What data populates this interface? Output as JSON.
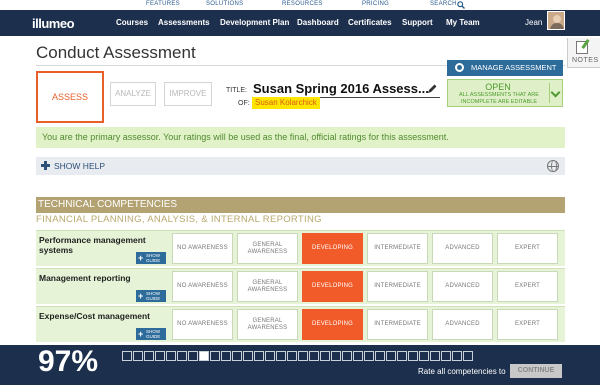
{
  "topbar": {
    "features": "FEATURES",
    "solutions": "SOLUTIONS",
    "resources": "RESOURCES",
    "pricing": "PRICING",
    "search": "SEARCH"
  },
  "nav": {
    "logo": "illumeo",
    "items": [
      "Courses",
      "Assessments",
      "Development Plan",
      "Dashboard",
      "Certificates",
      "Support",
      "My Team"
    ],
    "user": "Jean"
  },
  "notes_label": "NOTES",
  "page_title": "Conduct Assessment",
  "steps": {
    "assess": "ASSESS",
    "analyze": "ANALYZE",
    "improve": "IMPROVE"
  },
  "assessment": {
    "title_label": "TITLE:",
    "title_value": "Susan Spring 2016 Assess...",
    "of_label": "OF:",
    "of_value": "Susan Kolarchick"
  },
  "manage_button": "MANAGE ASSESSMENT",
  "status": {
    "title": "OPEN",
    "subtitle": "ALL ASSESSMENTS THAT ARE INCOMPLETE ARE EDITABLE"
  },
  "notice": "You are the primary assessor. Your ratings will be used as the final, official ratings for this assessment.",
  "help_label": "SHOW HELP",
  "section_header": "TECHNICAL COMPETENCIES",
  "sub_header": "FINANCIAL PLANNING, ANALYSIS, & INTERNAL REPORTING",
  "rating_levels": [
    "NO AWARENESS",
    "GENERAL AWARENESS",
    "DEVELOPING",
    "INTERMEDIATE",
    "ADVANCED",
    "EXPERT"
  ],
  "show_guide": {
    "plus": "+",
    "text": "SHOW GUIDE"
  },
  "competencies": [
    {
      "name": "Performance management systems",
      "selected": "DEVELOPING"
    },
    {
      "name": "Management reporting",
      "selected": "DEVELOPING"
    },
    {
      "name": "Expense/Cost management",
      "selected": "DEVELOPING"
    }
  ],
  "footer": {
    "percent": "97%",
    "progress_total": 32,
    "progress_current": 8,
    "rate_all_label": "Rate all competencies to",
    "continue": "CONTINUE"
  },
  "colors": {
    "nav": "#1c2f4d",
    "accent_orange": "#f15b2a",
    "open_green": "#4e9a2f",
    "section_tan": "#b3a372",
    "manage_blue": "#2d6b9a"
  }
}
